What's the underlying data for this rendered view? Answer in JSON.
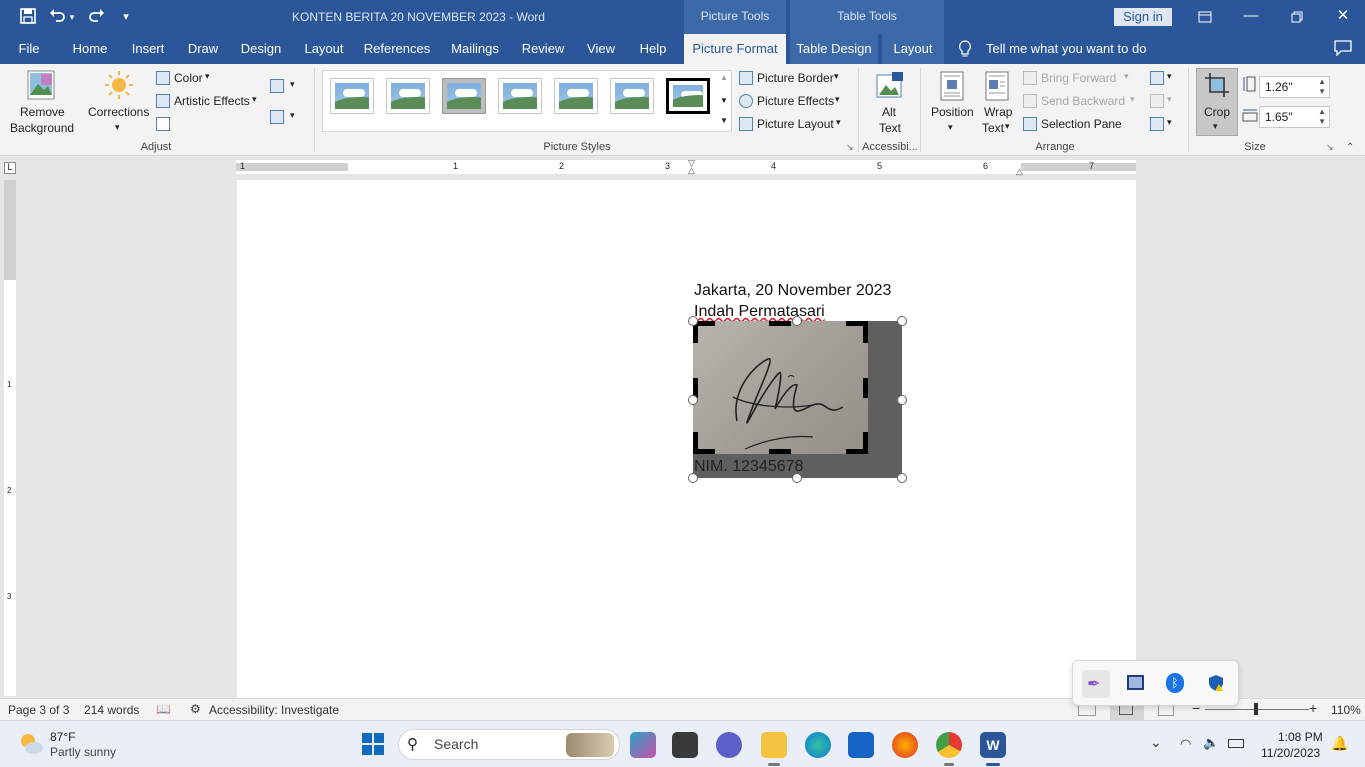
{
  "window": {
    "title": "KONTEN BERITA 20 NOVEMBER 2023  -  Word",
    "sign_in": "Sign in",
    "context_picture_tools": "Picture Tools",
    "context_table_tools": "Table Tools"
  },
  "tabs": [
    "File",
    "Home",
    "Insert",
    "Draw",
    "Design",
    "Layout",
    "References",
    "Mailings",
    "Review",
    "View",
    "Help",
    "Picture Format",
    "Table Design",
    "Layout"
  ],
  "tell_me": "Tell me what you want to do",
  "ribbon": {
    "adjust": {
      "label": "Adjust",
      "remove_background": [
        "Remove",
        "Background"
      ],
      "corrections": "Corrections",
      "color": "Color",
      "artistic_effects": "Artistic Effects"
    },
    "picture_styles": {
      "label": "Picture Styles",
      "picture_border": "Picture Border",
      "picture_effects": "Picture Effects",
      "picture_layout": "Picture Layout"
    },
    "accessibility": {
      "label": "Accessibi...",
      "alt_text": [
        "Alt",
        "Text"
      ]
    },
    "arrange": {
      "label": "Arrange",
      "position": "Position",
      "wrap_text": [
        "Wrap",
        "Text"
      ],
      "bring_forward": "Bring Forward",
      "send_backward": "Send Backward",
      "selection_pane": "Selection Pane"
    },
    "size": {
      "label": "Size",
      "crop": "Crop",
      "height": "1.26\"",
      "width": "1.65\""
    }
  },
  "ruler": {
    "h_numbers": [
      "1",
      "1",
      "2",
      "3",
      "4",
      "5",
      "6",
      "7"
    ],
    "v_numbers": [
      "1",
      "2",
      "3"
    ]
  },
  "document": {
    "line1": "Jakarta, 20 November 2023",
    "line2": "Indah Permatasari",
    "line3": "NIM. 12345678"
  },
  "status": {
    "page": "Page 3 of 3",
    "words": "214 words",
    "accessibility": "Accessibility: Investigate",
    "zoom": "110%"
  },
  "taskbar": {
    "weather_temp": "87°F",
    "weather_desc": "Partly sunny",
    "search": "Search",
    "time": "1:08 PM",
    "date": "11/20/2023"
  },
  "colors": {
    "word_blue": "#2b579a",
    "ribbon_bg": "#f3f3f3",
    "page_bg": "#ffffff"
  }
}
